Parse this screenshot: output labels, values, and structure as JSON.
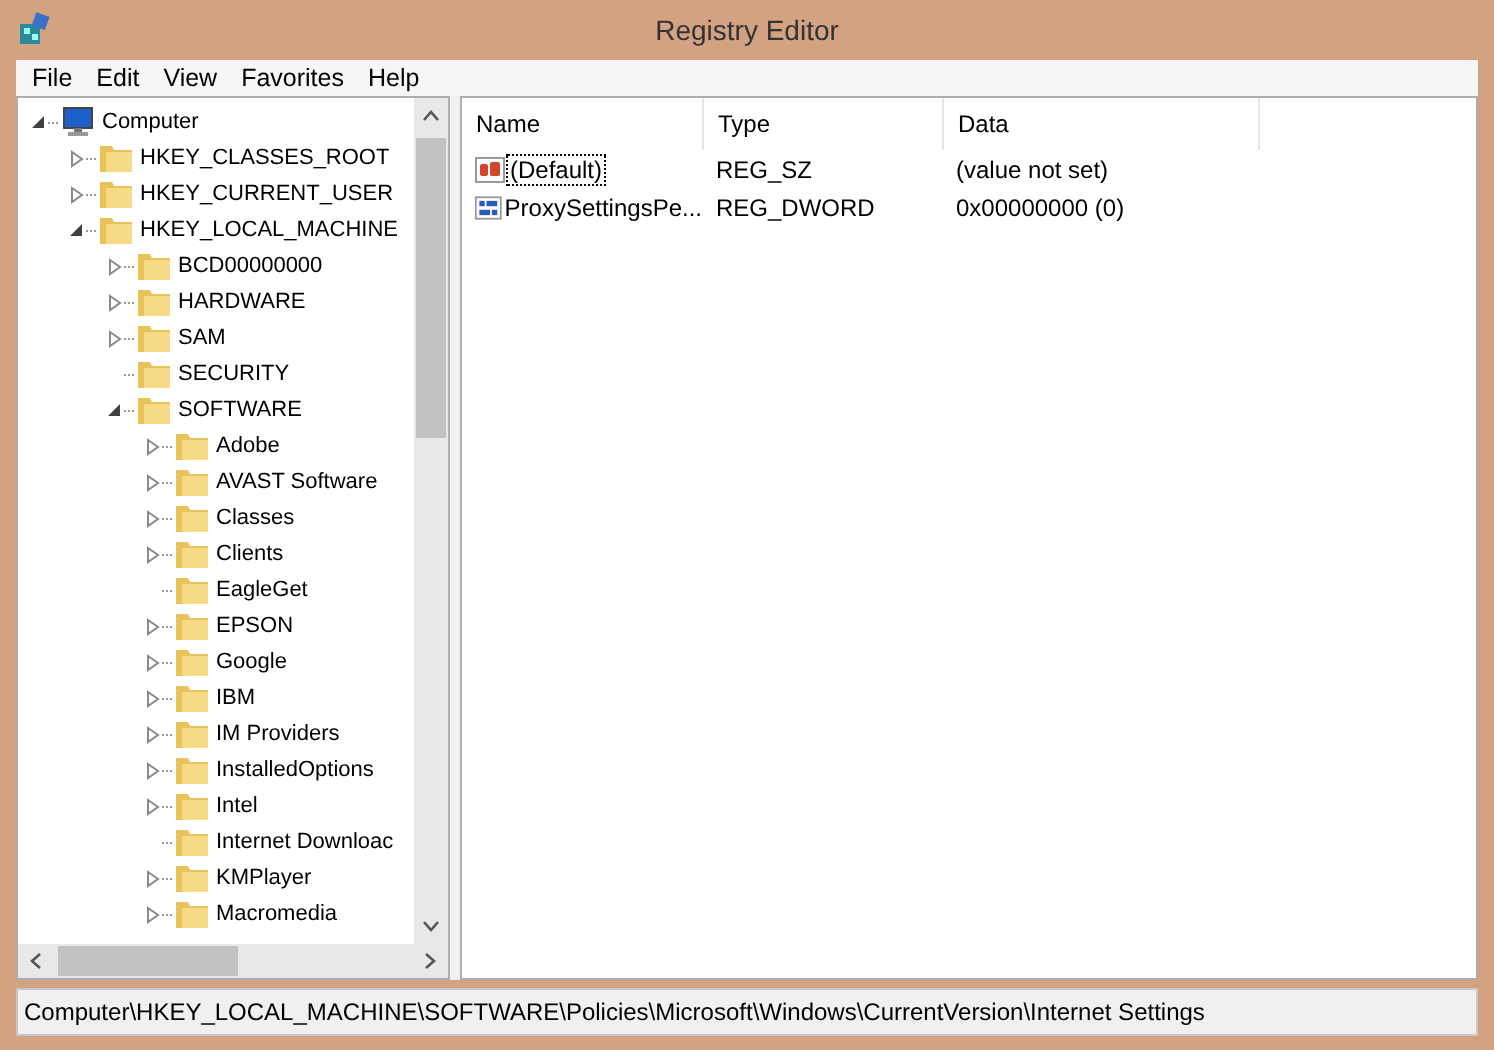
{
  "window": {
    "title": "Registry Editor"
  },
  "menu": [
    "File",
    "Edit",
    "View",
    "Favorites",
    "Help"
  ],
  "tree": [
    {
      "label": "Computer",
      "kind": "computer",
      "expanded": true,
      "children": [
        {
          "label": "HKEY_CLASSES_ROOT",
          "kind": "branch",
          "expanded": false
        },
        {
          "label": "HKEY_CURRENT_USER",
          "kind": "branch",
          "expanded": false
        },
        {
          "label": "HKEY_LOCAL_MACHINE",
          "kind": "branch",
          "expanded": true,
          "children": [
            {
              "label": "BCD00000000",
              "kind": "branch",
              "expanded": false
            },
            {
              "label": "HARDWARE",
              "kind": "branch",
              "expanded": false
            },
            {
              "label": "SAM",
              "kind": "branch",
              "expanded": false
            },
            {
              "label": "SECURITY",
              "kind": "leaf"
            },
            {
              "label": "SOFTWARE",
              "kind": "branch",
              "expanded": true,
              "children": [
                {
                  "label": "Adobe",
                  "kind": "branch",
                  "expanded": false
                },
                {
                  "label": "AVAST Software",
                  "kind": "branch",
                  "expanded": false
                },
                {
                  "label": "Classes",
                  "kind": "branch",
                  "expanded": false
                },
                {
                  "label": "Clients",
                  "kind": "branch",
                  "expanded": false
                },
                {
                  "label": "EagleGet",
                  "kind": "leaf"
                },
                {
                  "label": "EPSON",
                  "kind": "branch",
                  "expanded": false
                },
                {
                  "label": "Google",
                  "kind": "branch",
                  "expanded": false
                },
                {
                  "label": "IBM",
                  "kind": "branch",
                  "expanded": false
                },
                {
                  "label": "IM Providers",
                  "kind": "branch",
                  "expanded": false
                },
                {
                  "label": "InstalledOptions",
                  "kind": "branch",
                  "expanded": false
                },
                {
                  "label": "Intel",
                  "kind": "branch",
                  "expanded": false
                },
                {
                  "label": "Internet Downloac",
                  "kind": "leaf"
                },
                {
                  "label": "KMPlayer",
                  "kind": "branch",
                  "expanded": false
                },
                {
                  "label": "Macromedia",
                  "kind": "branch",
                  "expanded": false
                }
              ]
            }
          ]
        }
      ]
    }
  ],
  "table": {
    "columns": [
      "Name",
      "Type",
      "Data"
    ],
    "rows": [
      {
        "kind": "string",
        "selected": true,
        "cells": [
          "(Default)",
          "REG_SZ",
          "(value not set)"
        ]
      },
      {
        "kind": "binary",
        "selected": false,
        "cells": [
          "ProxySettingsPe...",
          "REG_DWORD",
          "0x00000000 (0)"
        ]
      }
    ]
  },
  "status_bar": "Computer\\HKEY_LOCAL_MACHINE\\SOFTWARE\\Policies\\Microsoft\\Windows\\CurrentVersion\\Internet Settings"
}
